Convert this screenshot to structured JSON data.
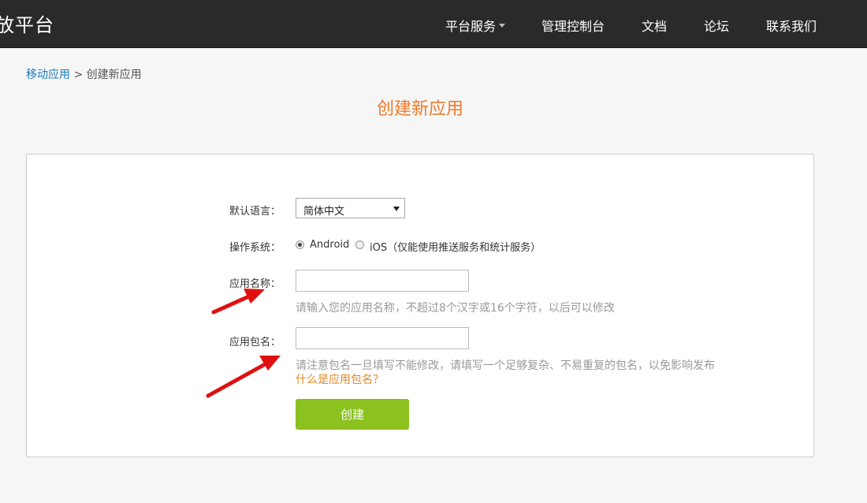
{
  "header": {
    "brand": "放平台",
    "nav": [
      {
        "label": "平台服务",
        "has_dropdown": true
      },
      {
        "label": "管理控制台"
      },
      {
        "label": "文档"
      },
      {
        "label": "论坛"
      },
      {
        "label": "联系我们"
      }
    ]
  },
  "breadcrumb": {
    "parent": "移动应用",
    "separator": ">",
    "current": "创建新应用"
  },
  "page_title": "创建新应用",
  "form": {
    "language": {
      "label": "默认语言：",
      "selected": "简体中文"
    },
    "os": {
      "label": "操作系统：",
      "options": [
        {
          "label": "Android",
          "checked": true
        },
        {
          "label": "iOS（仅能使用推送服务和统计服务）",
          "checked": false
        }
      ]
    },
    "app_name": {
      "label": "应用名称：",
      "value": "",
      "hint": "请输入您的应用名称，不超过8个汉字或16个字符，以后可以修改"
    },
    "package_name": {
      "label": "应用包名：",
      "value": "",
      "hint": "请注意包名一旦填写不能修改，请填写一个足够复杂、不易重复的包名，以免影响发布",
      "help_link": "什么是应用包名？"
    },
    "submit_label": "创建"
  },
  "colors": {
    "topbar": "#2a2a2a",
    "title_orange": "#ee7a2a",
    "link_blue": "#1b7ab8",
    "button_green": "#8bc21f",
    "help_orange": "#e08a1e",
    "annotation_red": "#e01010"
  }
}
